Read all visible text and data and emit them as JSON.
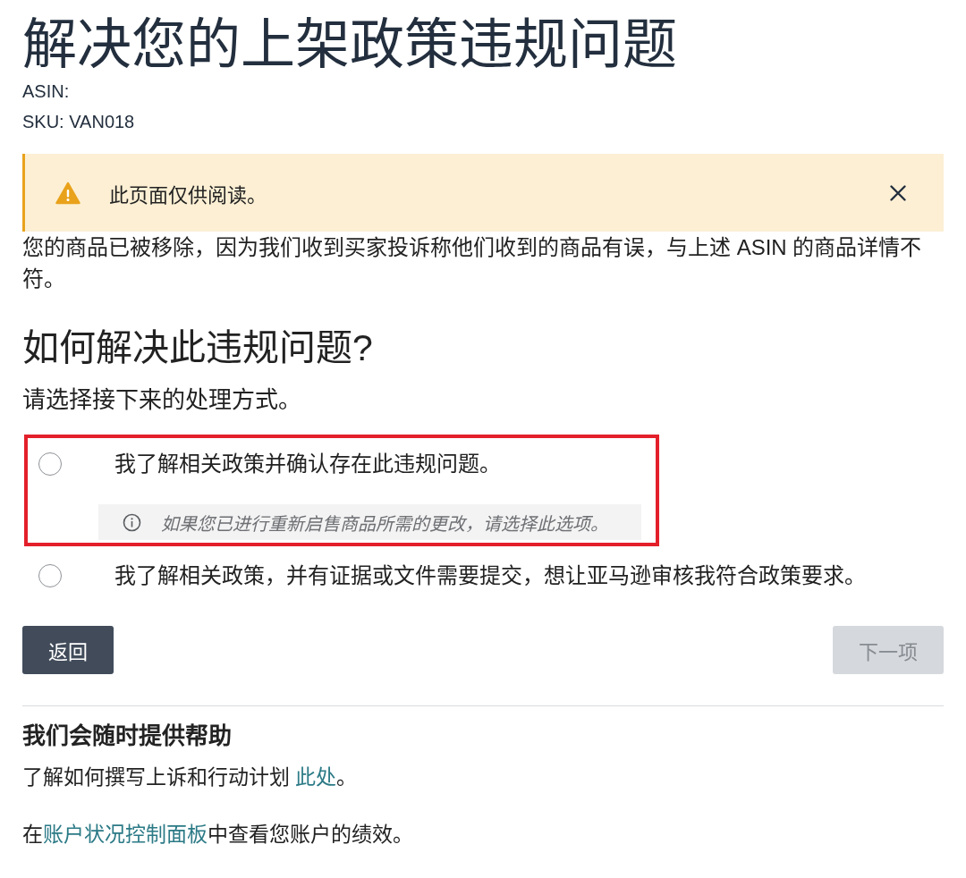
{
  "page": {
    "title": "解决您的上架政策违规问题",
    "asin": "ASIN:",
    "sku": "SKU: VAN018"
  },
  "alert": {
    "kind": "warning",
    "text": "此页面仅供阅读。",
    "dismissible": true
  },
  "removal_notice": "您的商品已被移除，因为我们收到买家投诉称他们收到的商品有误，与上述 ASIN 的商品详情不符。",
  "resolution": {
    "heading": "如何解决此违规问题?",
    "prompt": "请选择接下来的处理方式。",
    "options": [
      {
        "label": "我了解相关政策并确认存在此违规问题。",
        "note": "如果您已进行重新启售商品所需的更改，请选择此选项。",
        "selected": false,
        "highlighted": true
      },
      {
        "label": "我了解相关政策，并有证据或文件需要提交，想让亚马逊审核我符合政策要求。",
        "selected": false,
        "highlighted": false
      }
    ]
  },
  "buttons": [
    {
      "label": "返回",
      "disabled": false
    },
    {
      "label": "下一项",
      "disabled": true
    }
  ],
  "help": {
    "heading": "我们会随时提供帮助",
    "lines": [
      {
        "before": "了解如何撰写上诉和行动计划 ",
        "link": "此处",
        "after": "。"
      },
      {
        "before": "在",
        "link": "账户状况控制面板",
        "after": "中查看您账户的绩效。"
      }
    ]
  }
}
